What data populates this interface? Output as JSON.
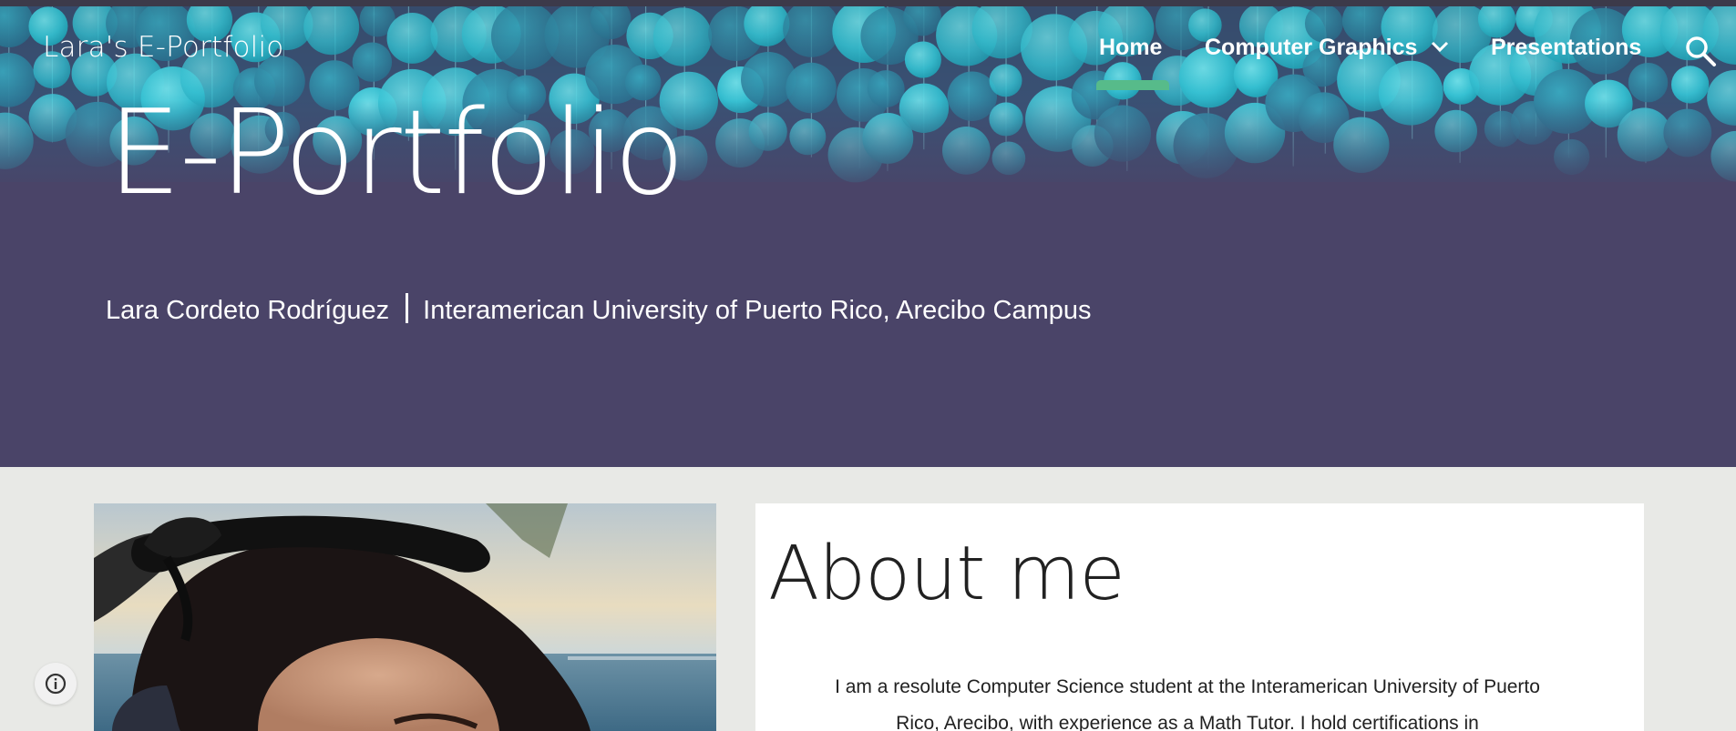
{
  "site": {
    "title": "Lara's E-Portfolio"
  },
  "nav": {
    "items": [
      {
        "label": "Home",
        "active": true
      },
      {
        "label": "Computer Graphics",
        "has_dropdown": true
      },
      {
        "label": "Presentations"
      }
    ],
    "search_icon": "search-icon"
  },
  "hero": {
    "heading": "E-Portfolio",
    "subtitle_name": "Lara Cordeto Rodríguez",
    "subtitle_school": "Interamerican University of Puerto Rico, Arecibo Campus"
  },
  "about": {
    "title": "About me",
    "text": "I am a resolute Computer Science student at the Interamerican University of Puerto Rico, Arecibo, with experience as a Math Tutor. I hold certifications in"
  },
  "colors": {
    "hero_bg": "#4a4468",
    "bubble": "#3ec6d6",
    "nav_underline": "#57bb8a",
    "page_bg": "#e8e9e6",
    "text_dark": "#212121"
  },
  "icons": {
    "info": "info-icon",
    "chevron": "chevron-down-icon"
  }
}
